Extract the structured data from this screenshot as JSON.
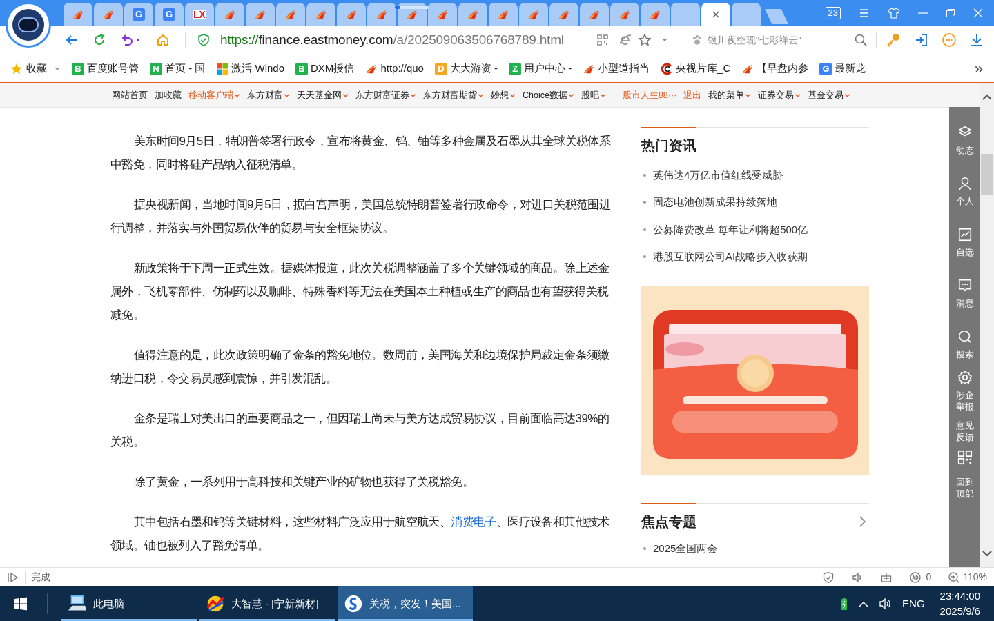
{
  "tabs": [
    {
      "kind": "swoosh",
      "selected": false,
      "loading": false
    },
    {
      "kind": "swoosh",
      "selected": false,
      "loading": false
    },
    {
      "kind": "letter",
      "badge": "G",
      "color": "#3b82f6",
      "selected": false,
      "loading": false
    },
    {
      "kind": "letter",
      "badge": "G",
      "color": "#3b82f6",
      "selected": false,
      "loading": false
    },
    {
      "kind": "text",
      "badge": "LX",
      "color": "#e0201b",
      "selected": false,
      "loading": false
    },
    {
      "kind": "swoosh",
      "selected": false,
      "loading": false
    },
    {
      "kind": "swoosh",
      "selected": false,
      "loading": false
    },
    {
      "kind": "swoosh",
      "selected": false,
      "loading": false
    },
    {
      "kind": "swoosh",
      "selected": false,
      "loading": false
    },
    {
      "kind": "swoosh",
      "selected": false,
      "loading": false
    },
    {
      "kind": "swoosh",
      "selected": false,
      "loading": false
    },
    {
      "kind": "swoosh",
      "selected": false,
      "loading": true
    },
    {
      "kind": "swoosh",
      "selected": false,
      "loading": false
    },
    {
      "kind": "swoosh",
      "selected": false,
      "loading": false
    },
    {
      "kind": "swoosh",
      "selected": false,
      "loading": false
    },
    {
      "kind": "swoosh",
      "selected": false,
      "loading": false
    },
    {
      "kind": "swoosh",
      "selected": false,
      "loading": false
    },
    {
      "kind": "swoosh",
      "selected": false,
      "loading": false
    },
    {
      "kind": "swoosh",
      "selected": false,
      "loading": false
    },
    {
      "kind": "swoosh",
      "selected": false,
      "loading": false
    },
    {
      "kind": "blank",
      "selected": false,
      "loading": false
    },
    {
      "kind": "blank",
      "selected": true,
      "loading": false
    },
    {
      "kind": "blank",
      "selected": false,
      "loading": false
    }
  ],
  "tab_counter": "23",
  "address_bar": {
    "url": {
      "scheme": "https://",
      "host": "finance.eastmoney.com",
      "path": "/a/202509063506768789.html"
    },
    "search_placeholder": "银川夜空现\"七彩祥云\""
  },
  "bookmarks": [
    {
      "kind": "favorites",
      "label": "收藏"
    },
    {
      "kind": "letter",
      "badge": "B",
      "color": "#22b14c",
      "label": "百度账号管"
    },
    {
      "kind": "letter",
      "badge": "N",
      "color": "#22b14c",
      "label": "首页 - 国"
    },
    {
      "kind": "windows",
      "label": "激活 Windo"
    },
    {
      "kind": "letter",
      "badge": "B",
      "color": "#22b14c",
      "label": "DXM授信"
    },
    {
      "kind": "swoosh",
      "label": "http://quo"
    },
    {
      "kind": "letter",
      "badge": "D",
      "color": "#f5a623",
      "label": "大大游资 -"
    },
    {
      "kind": "letter",
      "badge": "Z",
      "color": "#22b14c",
      "label": "用户中心 -"
    },
    {
      "kind": "swoosh",
      "label": "小型道指当"
    },
    {
      "kind": "cctv",
      "label": "央视片库_C"
    },
    {
      "kind": "swoosh",
      "label": "【早盘内参"
    },
    {
      "kind": "letter",
      "badge": "G",
      "color": "#3b82f6",
      "label": "最新龙"
    }
  ],
  "bookmarks_more": "»",
  "site_nav": {
    "left": [
      {
        "label": "网站首页",
        "highlight": false,
        "dropdown": false
      },
      {
        "label": "加收藏",
        "highlight": false,
        "dropdown": false
      },
      {
        "label": "移动客户端",
        "highlight": true,
        "dropdown": true
      },
      {
        "label": "东方财富",
        "highlight": false,
        "dropdown": true
      },
      {
        "label": "天天基金网",
        "highlight": false,
        "dropdown": true
      },
      {
        "label": "东方财富证券",
        "highlight": false,
        "dropdown": true
      },
      {
        "label": "东方财富期货",
        "highlight": false,
        "dropdown": true
      },
      {
        "label": "妙想",
        "highlight": false,
        "dropdown": true
      },
      {
        "label": "Choice数据",
        "highlight": false,
        "dropdown": true
      },
      {
        "label": "股吧",
        "highlight": false,
        "dropdown": true
      }
    ],
    "right": [
      {
        "label": "股市人生88···",
        "highlight": true,
        "dropdown": false
      },
      {
        "label": "退出",
        "highlight": true,
        "dropdown": false
      },
      {
        "label": "我的菜单",
        "highlight": false,
        "dropdown": true
      },
      {
        "label": "证券交易",
        "highlight": false,
        "dropdown": true
      },
      {
        "label": "基金交易",
        "highlight": false,
        "dropdown": true
      }
    ]
  },
  "article": {
    "paragraphs": [
      {
        "segments": [
          {
            "text": "美东时间9月5日，特朗普签署行政令，宣布将黄金、钨、铀等多种金属及石墨从其全球关税体系中豁免，同时将硅产品纳入征税清单。",
            "link": false
          }
        ]
      },
      {
        "segments": [
          {
            "text": "据央视新闻，当地时间9月5日，据白宫声明，美国总统特朗普签署行政命令，对进口关税范围进行调整，并落实与外国贸易伙伴的贸易与安全框架协议。",
            "link": false
          }
        ]
      },
      {
        "segments": [
          {
            "text": "新政策将于下周一正式生效。据媒体报道，此次关税调整涵盖了多个关键领域的商品。除上述金属外，飞机零部件、仿制药以及咖啡、特殊香料等无法在美国本土种植或生产的商品也有望获得关税减免。",
            "link": false
          }
        ]
      },
      {
        "segments": [
          {
            "text": "值得注意的是，此次政策明确了金条的豁免地位。数周前，美国海关和边境保护局裁定金条须缴纳进口税，令交易员感到震惊，并引发混乱。",
            "link": false
          }
        ]
      },
      {
        "segments": [
          {
            "text": "金条是瑞士对美出口的重要商品之一，但因瑞士尚未与美方达成贸易协议，目前面临高达39%的关税。",
            "link": false
          }
        ]
      },
      {
        "segments": [
          {
            "text": "除了黄金，一系列用于高科技和关键产业的矿物也获得了关税豁免。",
            "link": false
          }
        ]
      },
      {
        "segments": [
          {
            "text": "其中包括石墨和钨等关键材料，这些材料广泛应用于航空航天、",
            "link": false
          },
          {
            "text": "消费电子",
            "link": true
          },
          {
            "text": "、医疗设备和其他技术领域。铀也被列入了豁免清单。",
            "link": false
          }
        ]
      }
    ]
  },
  "hot_news": {
    "title": "热门资讯",
    "items": [
      "英伟达4万亿市值红线受威胁",
      "固态电池创新成果持续落地",
      "公募降费改革 每年让利将超500亿",
      "港股互联网公司AI战略步入收获期"
    ]
  },
  "focus_topics": {
    "title": "焦点专题",
    "items": [
      "2025全国两会"
    ]
  },
  "side_toolbar": [
    {
      "kind": "layers",
      "label": "动态"
    },
    {
      "kind": "user",
      "label": "个人"
    },
    {
      "kind": "chart",
      "label": "自选"
    },
    {
      "kind": "chat",
      "label": "消息"
    },
    {
      "kind": "search",
      "label": "搜索"
    },
    {
      "kind": "gear",
      "label": "涉企举报"
    },
    {
      "kind": "text",
      "label": "意见反馈"
    },
    {
      "kind": "qr"
    },
    {
      "kind": "text",
      "label": "回到顶部"
    }
  ],
  "status_bar": {
    "text": "完成",
    "ad_count": "0",
    "zoom": "110%"
  },
  "taskbar": {
    "items": [
      {
        "kind": "computer",
        "label": "此电脑",
        "selected": false
      },
      {
        "kind": "chart_app",
        "label": "大智慧 - [宁新新材]",
        "selected": false
      },
      {
        "kind": "browser",
        "label": "关税，突发！美国...",
        "selected": true
      }
    ],
    "language": "ENG",
    "time": "23:44:00",
    "date": "2025/9/6"
  }
}
